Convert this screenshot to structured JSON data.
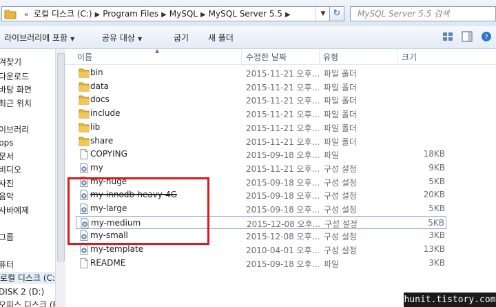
{
  "address_bar": {
    "overflow": "«",
    "segments": [
      "로컬 디스크 (C:)",
      "Program Files",
      "MySQL",
      "MySQL Server 5.5"
    ],
    "separator": "▶",
    "dropdown": "▼",
    "refresh": "↻",
    "search_placeholder": "MySQL Server 5.5 검색"
  },
  "toolbar": {
    "items": [
      "라이브러리에 포함",
      "공유 대상",
      "굽기",
      "새 폴더"
    ],
    "icons": [
      "view-options-icon",
      "preview-pane-icon",
      "help-icon"
    ]
  },
  "nav": {
    "items": [
      "겨찾기",
      "다운로드",
      "바탕 화면",
      "최근 위치",
      "이브러리",
      "pps",
      "문서",
      "비디오",
      "사진",
      "음악",
      "사바예제",
      "그룹",
      "퓨터",
      "로컬 디스크 (C:)",
      "DISK 2 (D:)",
      "오피스 디스크 (E:)"
    ]
  },
  "columns": [
    "이름",
    "수정한 날짜",
    "유형",
    "크기"
  ],
  "files": [
    {
      "name": "bin",
      "date": "2015-11-21 오후...",
      "type": "파일 폴더",
      "size": "",
      "icon": "folder"
    },
    {
      "name": "data",
      "date": "2015-11-21 오후...",
      "type": "파일 폴더",
      "size": "",
      "icon": "folder"
    },
    {
      "name": "docs",
      "date": "2015-11-21 오후...",
      "type": "파일 폴더",
      "size": "",
      "icon": "folder"
    },
    {
      "name": "include",
      "date": "2015-11-21 오후...",
      "type": "파일 폴더",
      "size": "",
      "icon": "folder"
    },
    {
      "name": "lib",
      "date": "2015-11-21 오후...",
      "type": "파일 폴더",
      "size": "",
      "icon": "folder"
    },
    {
      "name": "share",
      "date": "2015-11-21 오후...",
      "type": "파일 폴더",
      "size": "",
      "icon": "folder"
    },
    {
      "name": "COPYING",
      "date": "2015-09-18 오후...",
      "type": "파일",
      "size": "18KB",
      "icon": "file"
    },
    {
      "name": "my",
      "date": "2015-11-21 오후...",
      "type": "구성 설정",
      "size": "9KB",
      "icon": "config"
    },
    {
      "name": "my-huge",
      "date": "2015-09-18 오후...",
      "type": "구성 설정",
      "size": "5KB",
      "icon": "config"
    },
    {
      "name": "my-innodb-heavy-4G",
      "date": "2015-09-18 오후...",
      "type": "구성 설정",
      "size": "20KB",
      "icon": "config"
    },
    {
      "name": "my-large",
      "date": "2015-09-18 오후...",
      "type": "구성 설정",
      "size": "5KB",
      "icon": "config"
    },
    {
      "name": "my-medium",
      "date": "2015-12-08 오후...",
      "type": "구성 설정",
      "size": "5KB",
      "icon": "config"
    },
    {
      "name": "my-small",
      "date": "2015-12-08 오후...",
      "type": "구성 설정",
      "size": "3KB",
      "icon": "config"
    },
    {
      "name": "my-template",
      "date": "2010-04-01 오후...",
      "type": "구성 설정",
      "size": "13KB",
      "icon": "config"
    },
    {
      "name": "README",
      "date": "2015-09-18 오후...",
      "type": "파일",
      "size": "3KB",
      "icon": "file"
    }
  ],
  "selected_file": "my-medium",
  "struck_file": "my-innodb-heavy-4G",
  "watermark": "hunit.tistory.com",
  "colors": {
    "annotation_red": "#e6141b",
    "folder_yellow": "#e8b43a",
    "selection_border": "#84acdd"
  }
}
